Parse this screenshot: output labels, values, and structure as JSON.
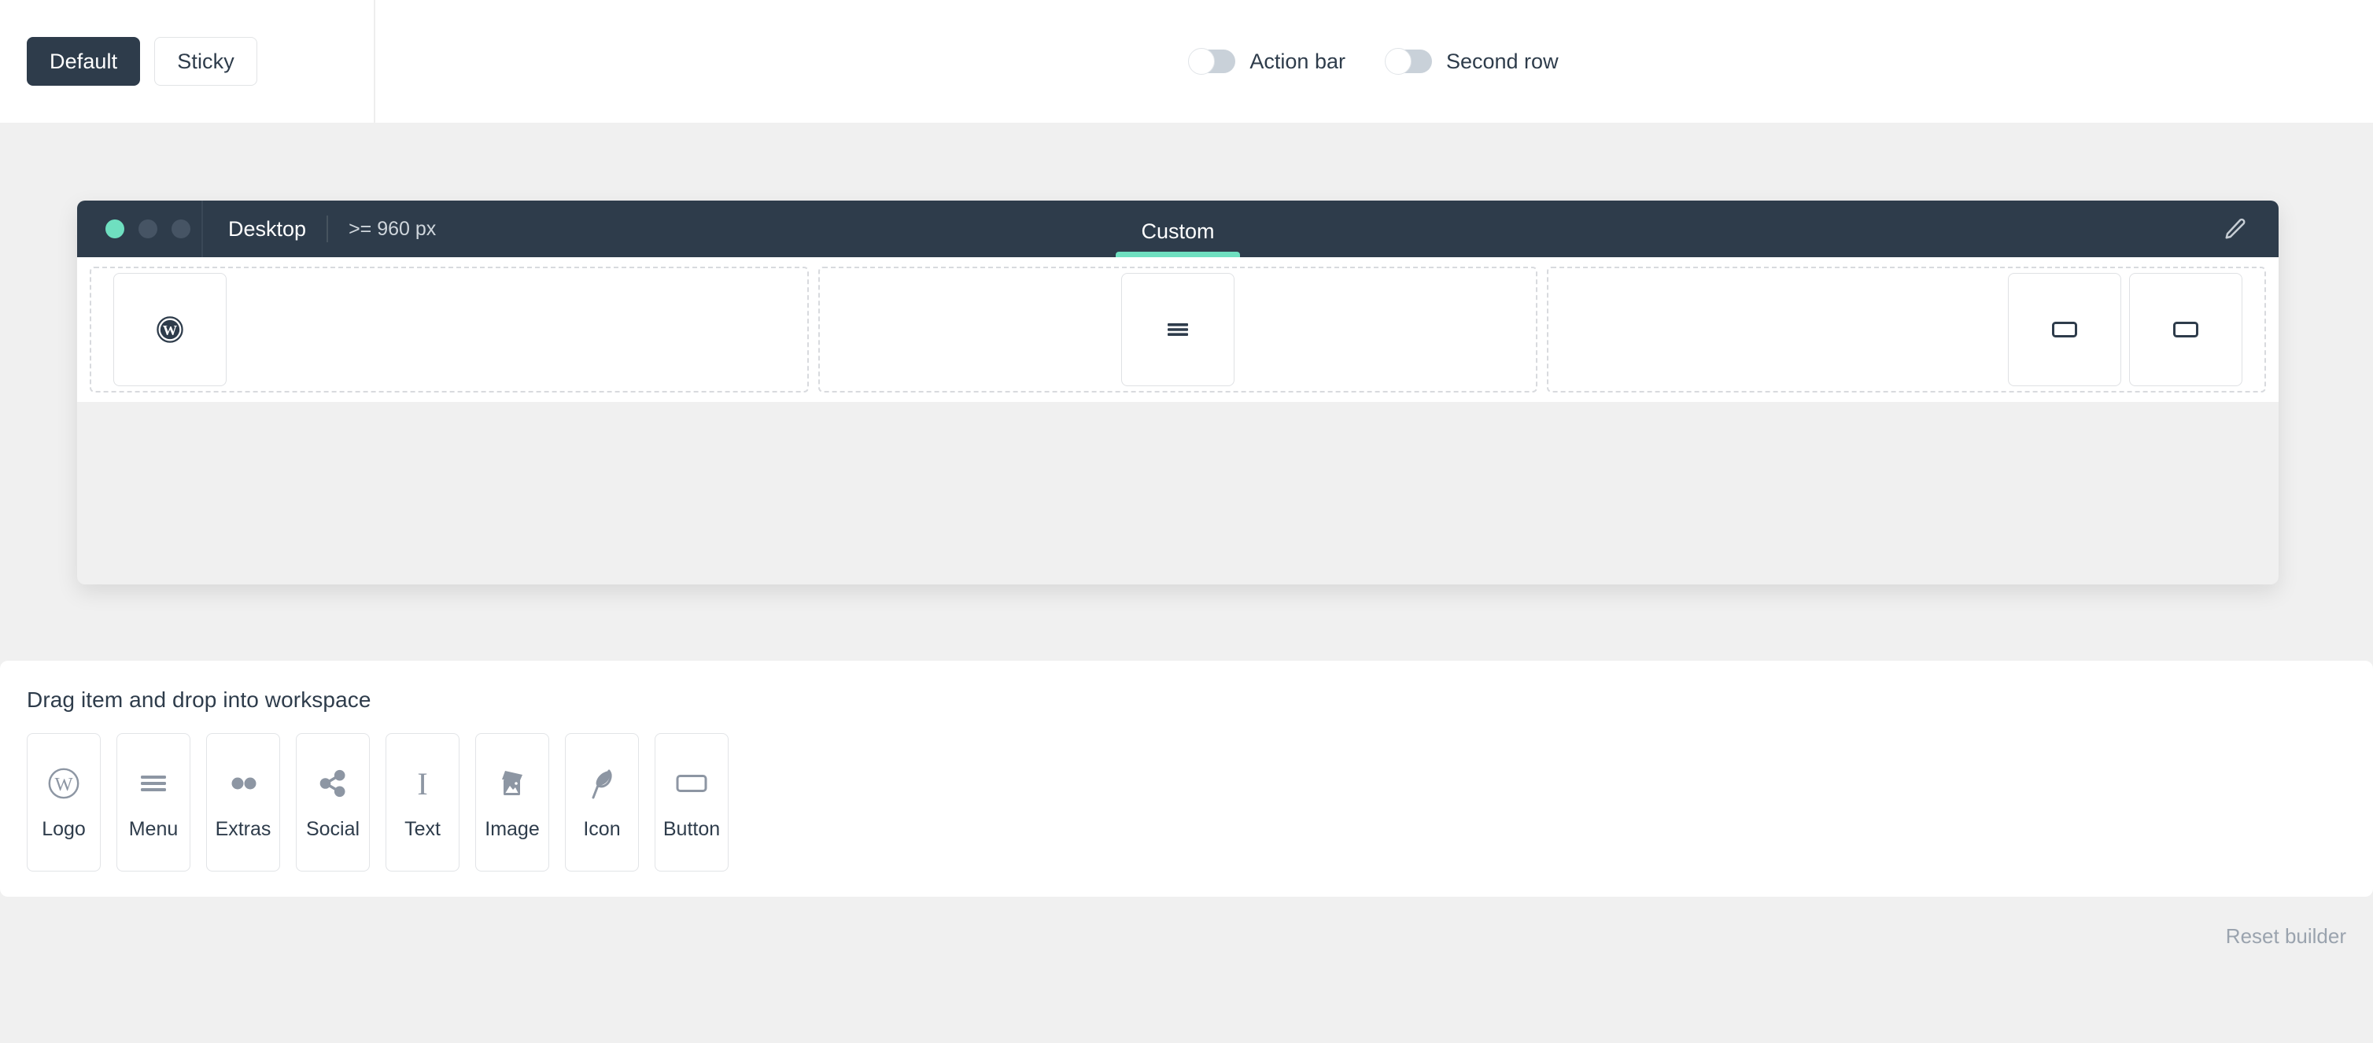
{
  "topbar": {
    "mode_buttons": [
      {
        "label": "Default",
        "active": true
      },
      {
        "label": "Sticky",
        "active": false
      }
    ],
    "toggles": [
      {
        "label": "Action bar",
        "on": false
      },
      {
        "label": "Second row",
        "on": false
      }
    ]
  },
  "workspace": {
    "device_name": "Desktop",
    "device_size": ">= 960 px",
    "tab_label": "Custom",
    "edit_icon": "pencil-icon",
    "window_dots": [
      "green",
      "grey",
      "grey"
    ],
    "zones": [
      {
        "name": "left",
        "items": [
          {
            "icon": "wordpress-icon"
          }
        ]
      },
      {
        "name": "center",
        "items": [
          {
            "icon": "menu-icon"
          }
        ]
      },
      {
        "name": "right",
        "items": [
          {
            "icon": "button-icon"
          },
          {
            "icon": "button-icon"
          }
        ]
      }
    ]
  },
  "library": {
    "title": "Drag item and drop into workspace",
    "items": [
      {
        "label": "Logo",
        "icon": "wordpress-icon"
      },
      {
        "label": "Menu",
        "icon": "menu-icon"
      },
      {
        "label": "Extras",
        "icon": "extras-dots-icon"
      },
      {
        "label": "Social",
        "icon": "share-icon"
      },
      {
        "label": "Text",
        "icon": "text-serif-i-icon"
      },
      {
        "label": "Image",
        "icon": "image-icon"
      },
      {
        "label": "Icon",
        "icon": "feather-icon"
      },
      {
        "label": "Button",
        "icon": "button-icon"
      }
    ]
  },
  "footer": {
    "reset_label": "Reset builder"
  },
  "colors": {
    "accent_mint": "#6fdfc0",
    "dark_slate": "#2e3c4b",
    "page_bg": "#f0f0f0",
    "icon_grey": "#8d96a3"
  }
}
